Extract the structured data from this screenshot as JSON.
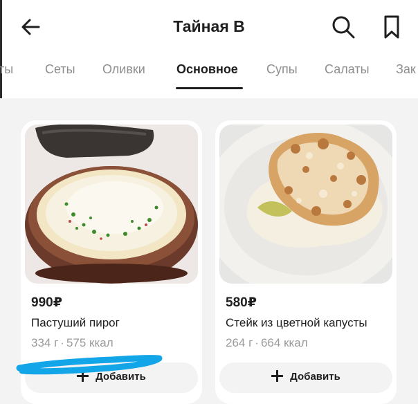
{
  "header": {
    "title": "Тайная В",
    "back_icon": "arrow-left-icon",
    "search_icon": "search-icon",
    "bookmark_icon": "bookmark-icon"
  },
  "tabs": [
    {
      "label": "ты",
      "active": false
    },
    {
      "label": "Сеты",
      "active": false
    },
    {
      "label": "Оливки",
      "active": false
    },
    {
      "label": "Основное",
      "active": true
    },
    {
      "label": "Супы",
      "active": false
    },
    {
      "label": "Салаты",
      "active": false
    },
    {
      "label": "Зак",
      "active": false
    }
  ],
  "products": [
    {
      "price": "990₽",
      "name": "Пастуший пирог",
      "weight": "334 г",
      "separator": "·",
      "calories": "575 ккал",
      "add_label": "Добавить",
      "image": "shepherds-pie-photo"
    },
    {
      "price": "580₽",
      "name": "Стейк из цветной капусты",
      "weight": "264 г",
      "separator": "·",
      "calories": "664 ккал",
      "add_label": "Добавить",
      "image": "cauliflower-steak-photo"
    }
  ],
  "colors": {
    "text": "#1f1f1f",
    "muted": "#8e8e8e",
    "background": "#f3f3f3",
    "scribble": "#12a5e8"
  }
}
